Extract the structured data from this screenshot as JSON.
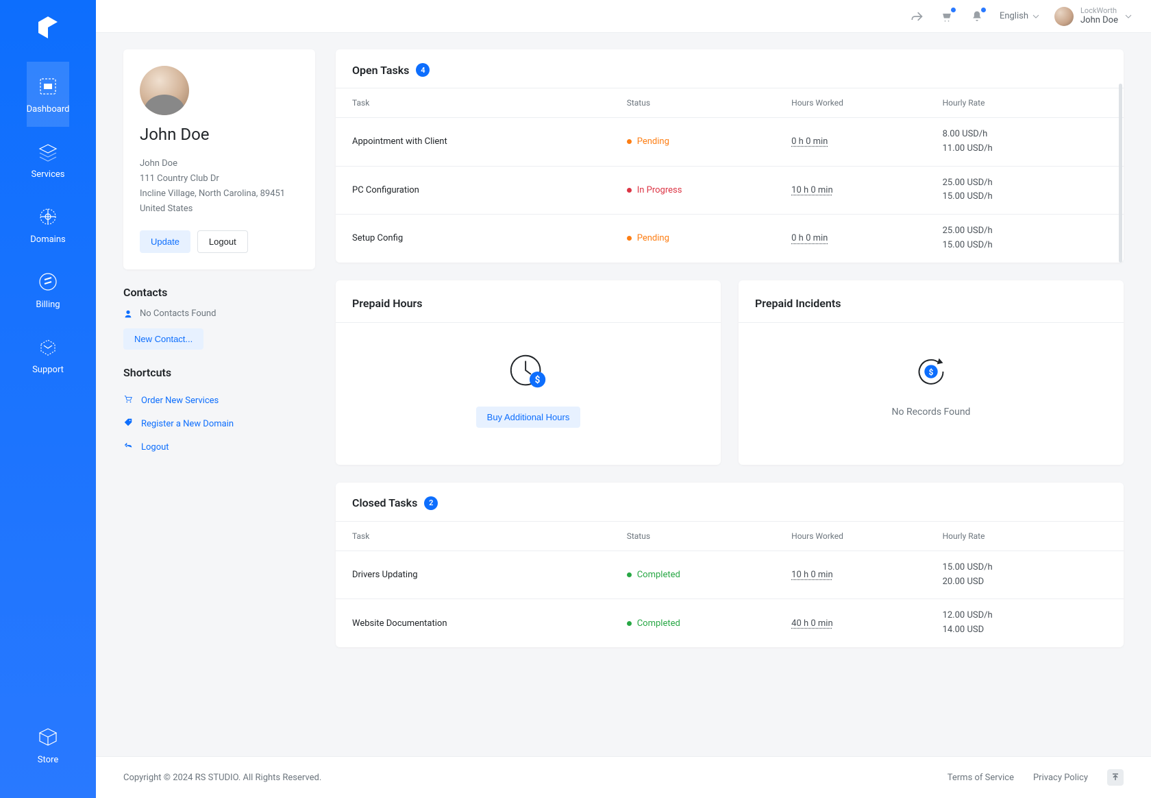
{
  "topbar": {
    "language": "English",
    "company": "LockWorth",
    "user_name": "John Doe"
  },
  "sidebar": {
    "items": [
      {
        "label": "Dashboard",
        "icon": "dashboard"
      },
      {
        "label": "Services",
        "icon": "services"
      },
      {
        "label": "Domains",
        "icon": "domains"
      },
      {
        "label": "Billing",
        "icon": "billing"
      },
      {
        "label": "Support",
        "icon": "support"
      }
    ],
    "bottom": {
      "label": "Store",
      "icon": "store"
    }
  },
  "profile": {
    "display_name": "John Doe",
    "name_line": "John Doe",
    "address1": "111 Country Club Dr",
    "address2": "Incline Village, North Carolina, 89451",
    "country": "United States",
    "update_label": "Update",
    "logout_label": "Logout"
  },
  "contacts": {
    "title": "Contacts",
    "empty": "No Contacts Found",
    "new_label": "New Contact..."
  },
  "shortcuts": {
    "title": "Shortcuts",
    "items": [
      {
        "label": "Order New Services",
        "icon": "cart"
      },
      {
        "label": "Register a New Domain",
        "icon": "tag"
      },
      {
        "label": "Logout",
        "icon": "reply"
      }
    ]
  },
  "open_tasks": {
    "title": "Open Tasks",
    "count": "4",
    "headers": {
      "task": "Task",
      "status": "Status",
      "hours": "Hours Worked",
      "rate": "Hourly Rate"
    },
    "rows": [
      {
        "task": "Appointment with Client",
        "status": "Pending",
        "status_class": "pending",
        "hours": "0 h 0 min",
        "rate1": "8.00 USD/h",
        "rate2": "11.00 USD/h"
      },
      {
        "task": "PC Configuration",
        "status": "In Progress",
        "status_class": "progress",
        "hours": "10 h 0 min",
        "rate1": "25.00 USD/h",
        "rate2": "15.00 USD/h"
      },
      {
        "task": "Setup Config",
        "status": "Pending",
        "status_class": "pending",
        "hours": "0 h 0 min",
        "rate1": "25.00 USD/h",
        "rate2": "15.00 USD/h"
      }
    ]
  },
  "prepaid_hours": {
    "title": "Prepaid Hours",
    "cta": "Buy Additional Hours"
  },
  "prepaid_incidents": {
    "title": "Prepaid Incidents",
    "empty": "No Records Found"
  },
  "closed_tasks": {
    "title": "Closed Tasks",
    "count": "2",
    "headers": {
      "task": "Task",
      "status": "Status",
      "hours": "Hours Worked",
      "rate": "Hourly Rate"
    },
    "rows": [
      {
        "task": "Drivers Updating",
        "status": "Completed",
        "status_class": "completed",
        "hours": "10 h 0 min",
        "rate1": "15.00 USD/h",
        "rate2": "20.00 USD"
      },
      {
        "task": "Website Documentation",
        "status": "Completed",
        "status_class": "completed",
        "hours": "40 h 0 min",
        "rate1": "12.00 USD/h",
        "rate2": "14.00 USD"
      }
    ]
  },
  "footer": {
    "copyright": "Copyright © 2024 RS STUDIO. All Rights Reserved.",
    "tos": "Terms of Service",
    "privacy": "Privacy Policy"
  }
}
